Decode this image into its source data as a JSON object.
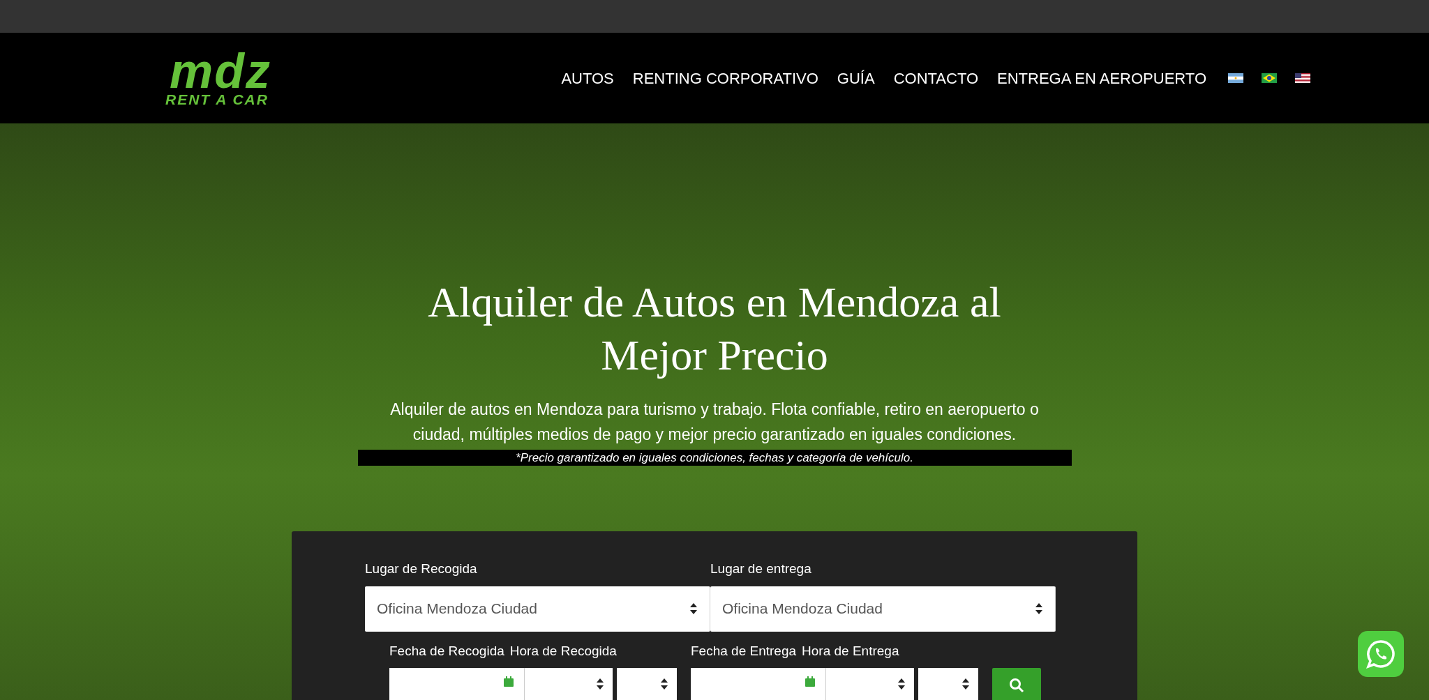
{
  "logo": {
    "title": "mdz",
    "subtitle": "RENT A CAR"
  },
  "nav": {
    "items": [
      "AUTOS",
      "RENTING CORPORATIVO",
      "GUÍA",
      "CONTACTO",
      "ENTREGA EN AEROPUERTO"
    ],
    "flags": [
      {
        "kind": "argentina"
      },
      {
        "kind": "brazil"
      },
      {
        "kind": "usa"
      }
    ]
  },
  "hero": {
    "title": "Alquiler de Autos en Mendoza al Mejor Precio",
    "subtitle": "Alquiler de autos en Mendoza para turismo y trabajo. Flota confiable, retiro en aeropuerto o ciudad, múltiples medios de pago y mejor precio garantizado en iguales condiciones.",
    "disclaimer": "*Precio garantizado en iguales condiciones, fechas y categoría de vehículo."
  },
  "booking_form": {
    "locations": [
      {
        "label": "Lugar de Recogida",
        "value": "Oficina Mendoza Ciudad"
      },
      {
        "label": "Lugar de entrega",
        "value": "Oficina Mendoza Ciudad"
      }
    ],
    "datetimes": [
      {
        "date_label": "Fecha de Recogida",
        "time_label": "Hora de Recogida"
      },
      {
        "date_label": "Fecha de Entrega",
        "time_label": "Hora de Entrega"
      }
    ]
  }
}
